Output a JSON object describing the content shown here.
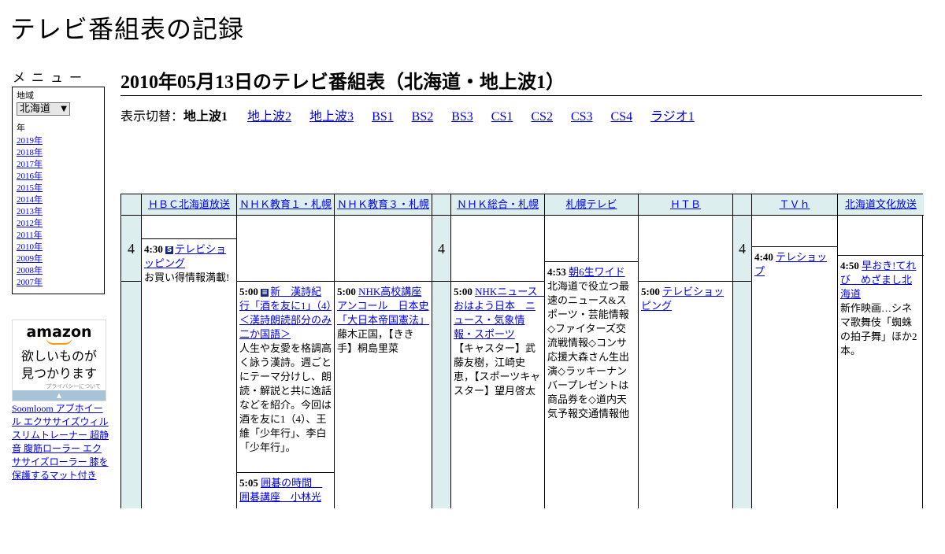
{
  "site_title": "テレビ番組表の記録",
  "menu": {
    "heading": "メニュー",
    "region_label": "地域",
    "region_value": "北海道",
    "year_label": "年",
    "years": [
      "2019年",
      "2018年",
      "2017年",
      "2016年",
      "2015年",
      "2014年",
      "2013年",
      "2012年",
      "2011年",
      "2010年",
      "2009年",
      "2008年",
      "2007年"
    ]
  },
  "ad": {
    "logo": "amazon",
    "text_line1": "欲しいものが",
    "text_line2": "見つかります",
    "privacy": "プライバシーについて",
    "links": "Soomloom アブホイール エクササイズウィル スリムトレーナー 超静音 腹筋ローラー エクササイズローラー 膝を保護するマット付き"
  },
  "page_heading": "2010年05月13日のテレビ番組表（北海道・地上波1）",
  "switcher": {
    "label": "表示切替：",
    "current": "地上波1",
    "links": [
      "地上波2",
      "地上波3",
      "BS1",
      "BS2",
      "BS3",
      "CS1",
      "CS2",
      "CS3",
      "CS4",
      "ラジオ1"
    ]
  },
  "hour_label": "4",
  "channels": [
    {
      "name": "ＨＢＣ北海道放送"
    },
    {
      "name": "ＮＨＫ教育１・札幌"
    },
    {
      "name": "ＮＨＫ教育３・札幌"
    },
    {
      "name": "ＮＨＫ総合・札幌"
    },
    {
      "name": "札幌テレビ"
    },
    {
      "name": "ＨＴＢ"
    },
    {
      "name": "ＴＶｈ"
    },
    {
      "name": "北海道文化放送"
    }
  ],
  "programs": {
    "hbc": {
      "time": "4:30",
      "mark": "S",
      "title": "テレビショッピング",
      "desc": "お買い得情報満載!"
    },
    "etv1_a": {
      "time": "5:00",
      "mark": "字",
      "title": "新　漢詩紀行「酒を友に1」（4）＜漢詩朗読部分のみ二か国語＞",
      "desc": "人生や友愛を格調高く詠う漢詩。週ごとにテーマ分けし、朗読・解説と共に逸話などを紹介。今回は酒を友に1（4）、王維「少年行」、李白「少年行」。"
    },
    "etv1_b": {
      "time": "5:05",
      "title": "囲碁の時間　囲碁講座　小林光"
    },
    "etv3": {
      "time": "5:00",
      "title": "NHK高校講座アンコール　日本史「大日本帝国憲法」",
      "desc": "藤木正国，【きき手】桐島里菜"
    },
    "nhkg": {
      "time": "5:00",
      "title": "NHKニュース　おはよう日本　ニュース・気象情報・スポーツ",
      "desc": "【キャスター】武藤友樹，江崎史恵，【スポーツキャスター】望月啓太"
    },
    "stv": {
      "time": "4:53",
      "title": "朝6生ワイド",
      "desc": "北海道で役立つ最速のニュース&スポーツ・芸能情報◇ファイターズ交流戦情報◇コンサ応援大森さん生出演◇ラッキーナンバープレゼントは商品券を◇道内天気予報交通情報他"
    },
    "htb": {
      "time": "5:00",
      "title": "テレビショッピング"
    },
    "tvh": {
      "time": "4:40",
      "title": "テレショップ"
    },
    "uhb": {
      "time": "4:50",
      "title": "早おき!てれび　めざまし北海道",
      "desc": "新作映画…シネマ歌舞伎「蜘蛛の拍子舞」ほか2本。"
    }
  }
}
